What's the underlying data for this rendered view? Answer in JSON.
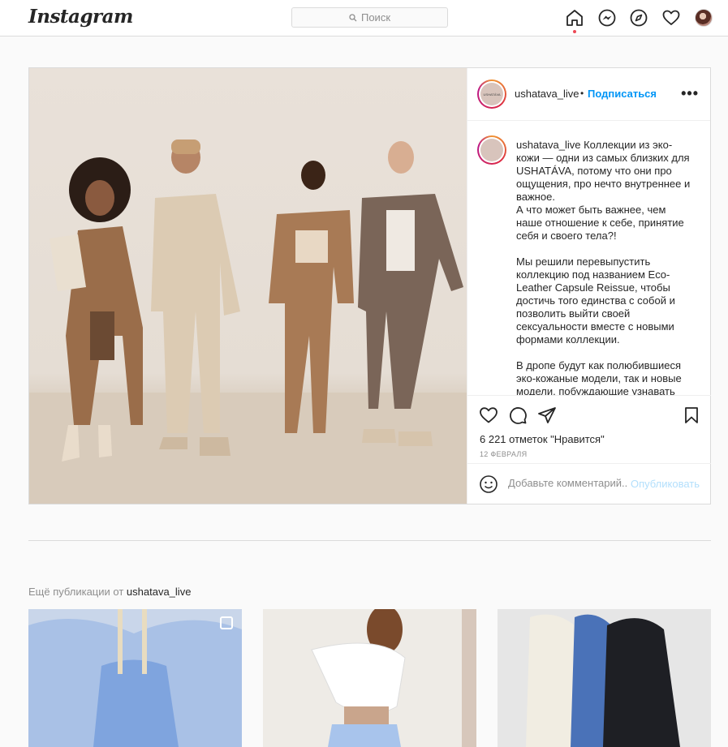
{
  "app": {
    "logo": "Instagram"
  },
  "search": {
    "placeholder": "Поиск"
  },
  "nav": {
    "icons": [
      "home-icon",
      "messenger-icon",
      "explore-icon",
      "activity-heart-icon",
      "profile-avatar"
    ]
  },
  "post": {
    "username": "ushatava_live",
    "separator": "•",
    "follow_label": "Подписаться",
    "more_label": "•••",
    "avatar_text": "USHATÁVA",
    "caption_username": "ushatava_live",
    "caption": " Коллекции из эко-кожи — одни из самых близких для USHATÁVA, потому что они про ощущения, про нечто внутреннее и важное.\nА что может быть важнее, чем наше отношение к себе, принятие себя и своего тела?!\n\nМы решили перевыпустить коллекцию под названием Eco-Leather Capsule Reissue, чтобы достичь того единства с собой и позволить выйти своей сексуальности вместе с новыми формами коллекции.\n\nВ дропе будут как полюбившиеся эко-кожаные модели, так и новые модели, побуждающие узнавать",
    "likes": "6 221 отметок \"Нравится\"",
    "date": "12 февраля",
    "comment_placeholder": "Добавьте комментарий...",
    "publish_label": "Опубликовать"
  },
  "more": {
    "prefix": "Ещё публикации от",
    "username": "ushatava_live"
  },
  "colors": {
    "accent": "#0095f6",
    "notification": "#ed4956",
    "border": "#dbdbdb",
    "muted": "#8e8e8e"
  }
}
